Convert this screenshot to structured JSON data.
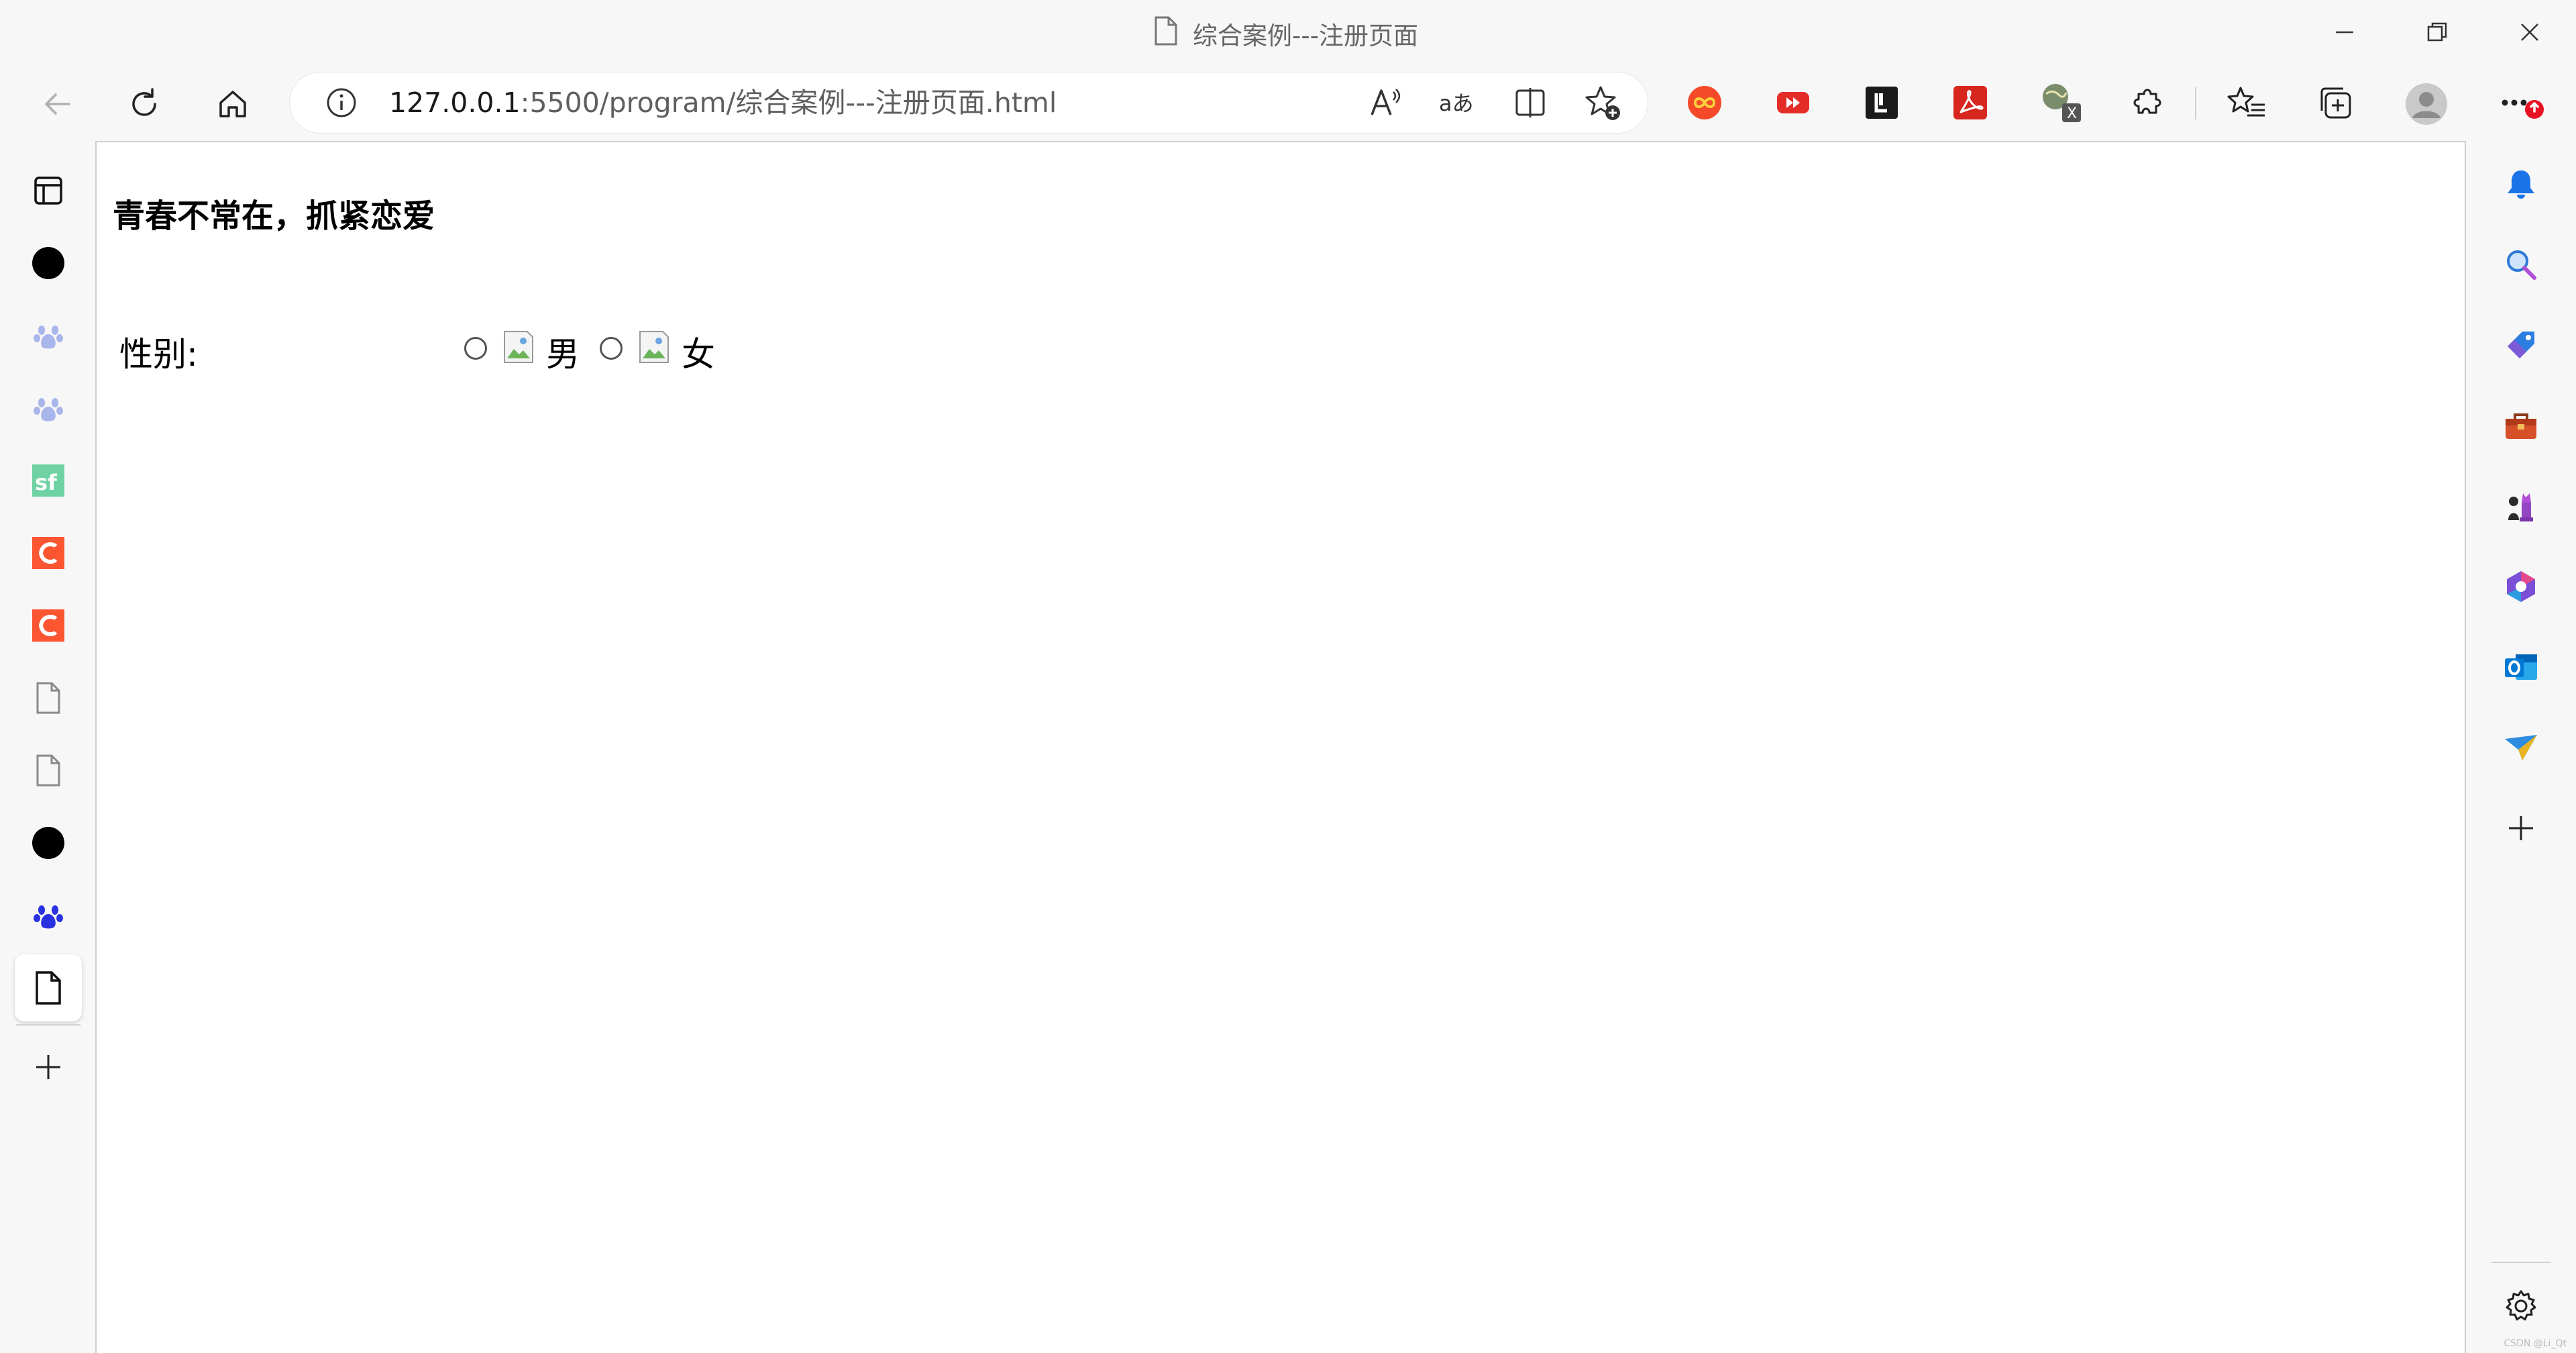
{
  "window": {
    "title": "综合案例---注册页面"
  },
  "toolbar": {
    "address_host": "127.0.0.1",
    "address_rest": ":5500/program/综合案例---注册页面.html"
  },
  "page": {
    "heading": "青春不常在，抓紧恋爱",
    "gender_label": "性别:",
    "option_male": "男",
    "option_female": "女"
  },
  "extensions": {
    "ext_x_badge": "X"
  },
  "watermark": "CSDN @Li_Qt",
  "colors": {
    "accent_blue": "#1a73e8",
    "page_bg": "#ffffff",
    "chrome_bg": "#f7f7f7",
    "csdn_red": "#fc5531",
    "sf_green": "#0bb16f"
  }
}
